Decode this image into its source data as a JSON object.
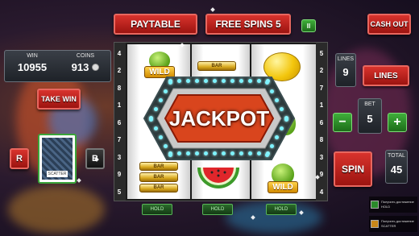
{
  "top": {
    "paytable_label": "PAYTABLE",
    "free_spins_label": "FREE SPINS 5",
    "pause_glyph": "II",
    "cashout_label": "CASH OUT"
  },
  "stats": {
    "win_label": "WIN",
    "win_value": "10955",
    "coins_label": "COINS",
    "coins_value": "913"
  },
  "left": {
    "take_win_label": "TAKE WIN",
    "red_label": "R",
    "black_label": "B",
    "card_label": "SCATTER"
  },
  "reels": {
    "left_numbers": [
      "4",
      "2",
      "8",
      "1",
      "6",
      "7",
      "3",
      "9",
      "5"
    ],
    "right_numbers": [
      "5",
      "2",
      "7",
      "1",
      "6",
      "8",
      "3",
      "9",
      "4"
    ],
    "hold_label": "HOLD",
    "wild_label": "WILD",
    "bar_label": "BAR"
  },
  "jackpot": {
    "text": "JACKPOT"
  },
  "right": {
    "lines_label": "LINES",
    "lines_value": "9",
    "lines_button": "LINES",
    "bet_label": "BET",
    "bet_value": "5",
    "minus_glyph": "−",
    "plus_glyph": "+",
    "spin_label": "SPIN",
    "total_label": "TOTAL",
    "total_value": "45"
  },
  "colors": {
    "accent_red": "#c8221d",
    "accent_green": "#2f8f2b",
    "jackpot_orange": "#d9451d"
  },
  "notifications": [
    {
      "title": "Получить достижение",
      "subtitle": "HOLD"
    },
    {
      "title": "Получить достижение",
      "subtitle": "SCATTER"
    }
  ]
}
